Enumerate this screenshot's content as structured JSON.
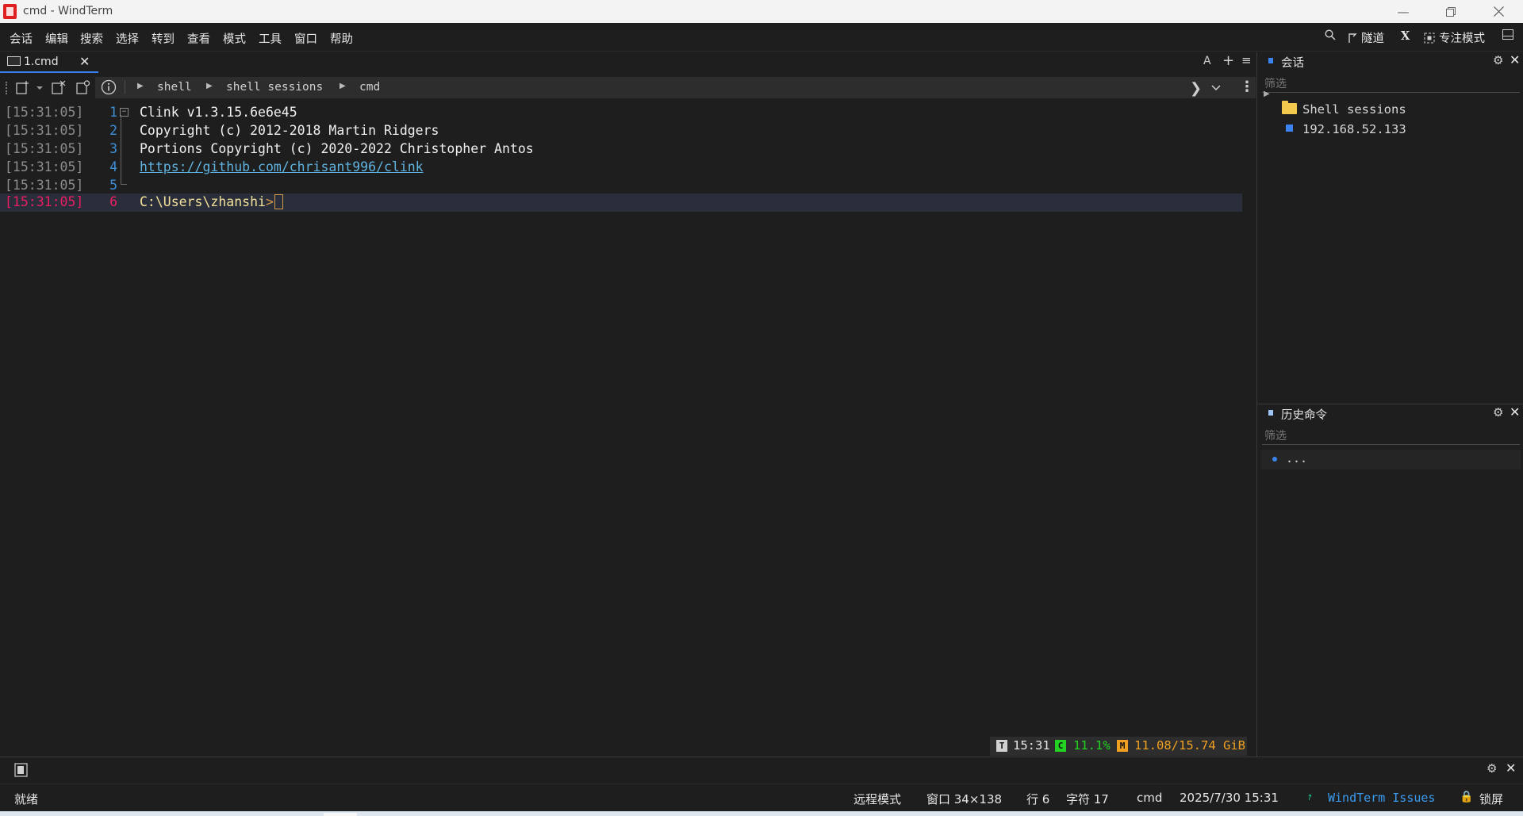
{
  "window": {
    "title": "cmd - WindTerm",
    "controls": [
      "minimize",
      "restore",
      "close"
    ]
  },
  "menu": {
    "items": [
      "会话",
      "编辑",
      "搜索",
      "选择",
      "转到",
      "查看",
      "模式",
      "工具",
      "窗口",
      "帮助"
    ],
    "right": {
      "tunnel_label": "隧道",
      "focus_label": "专注模式"
    }
  },
  "tabs": [
    {
      "label": "1.cmd",
      "active": true
    }
  ],
  "tab_actions": {
    "font_button": "A",
    "add_button": "+",
    "menu_button": "≡"
  },
  "breadcrumb": [
    "shell",
    "shell sessions",
    "cmd"
  ],
  "terminal": {
    "lines": [
      {
        "time": "[15:31:05]",
        "num": "1",
        "text": "Clink v1.3.15.6e6e45"
      },
      {
        "time": "[15:31:05]",
        "num": "2",
        "text": "Copyright (c) 2012-2018 Martin Ridgers"
      },
      {
        "time": "[15:31:05]",
        "num": "3",
        "text": "Portions Copyright (c) 2020-2022 Christopher Antos"
      },
      {
        "time": "[15:31:05]",
        "num": "4",
        "text": "https://github.com/chrisant996/clink"
      },
      {
        "time": "[15:31:05]",
        "num": "5",
        "text": ""
      },
      {
        "time": "[15:31:05]",
        "num": "6",
        "text": "C:\\Users\\zhanshi"
      }
    ],
    "prompt_symbol": ">"
  },
  "status_badge": {
    "time_tag": "T",
    "time": "15:31",
    "cpu_tag": "C",
    "cpu": "11.1%",
    "mem_tag": "M",
    "mem": "11.08/15.74 GiB"
  },
  "sessions_panel": {
    "title": "会话",
    "filter_placeholder": "筛选",
    "items": [
      {
        "label": "Shell sessions",
        "type": "folder"
      },
      {
        "label": "192.168.52.133",
        "type": "session"
      }
    ]
  },
  "history_panel": {
    "title": "历史命令",
    "filter_placeholder": "筛选",
    "items": [
      "..."
    ]
  },
  "statusbar": {
    "ready": "就绪",
    "remote_mode": "远程模式",
    "window_size": "窗口 34×138",
    "row": "行 6",
    "char": "字符 17",
    "shell": "cmd",
    "datetime": "2025/7/30 15:31",
    "issues_link": "WindTerm Issues",
    "lock": "锁屏"
  },
  "colors": {
    "accent_blue": "#3a83f1",
    "line_number": "#3d8fd6",
    "current_line_marker": "#e91e63",
    "link": "#5fb3e0",
    "cpu_green": "#22d322",
    "mem_orange": "#f0a020",
    "folder_yellow": "#f2c94c"
  }
}
